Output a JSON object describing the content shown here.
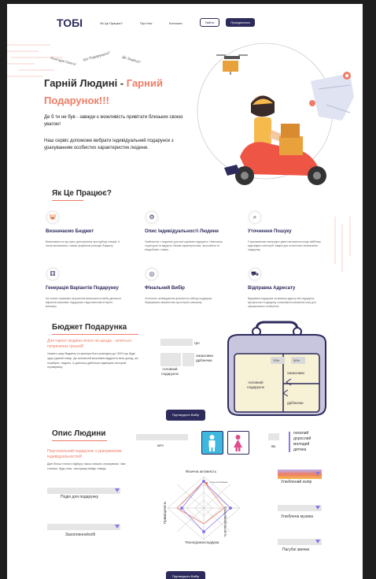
{
  "brand": {
    "logo": "ТОБІ"
  },
  "nav": {
    "items": [
      "Як Це Працює?",
      "Про Нас",
      "Контакти"
    ],
    "login": "Увійти",
    "signup": "Приєднатися"
  },
  "hero": {
    "notes": [
      "Сьогодні Свято!",
      "Що Подарувати?",
      "Де Знайти?"
    ],
    "title_plain": "Гарній Людині - ",
    "title_accent_1": "Гарний",
    "title_accent_2": "Подарунок!!!",
    "p1": "Де б ти не був - завжди є можливість привітати близьких своєю увагою!",
    "p2": "Наш сервіс допоможе вибрати індивідуальний подарунок з урахуванням особистих характеристик людини."
  },
  "how": {
    "title": "Як Це Працює?",
    "features": [
      {
        "icon": "piggy-bank-icon",
        "glyph": "🐷",
        "title": "Визначаємо Бюджет",
        "text": "Визначаємо на яку суму орієнтуватися при підбору товарів. А також визначаємо з якими форматом розподіл бюджету."
      },
      {
        "icon": "person-gear-icon",
        "glyph": "⚙",
        "title": "Опис Індивідуальності Людини",
        "text": "Знайомство з людиною для якої шукаємо подарунок. Невеличка структурна та відкрита. Вікова характеристика, захоплення та вподобання і смаки."
      },
      {
        "icon": "search-icon",
        "glyph": "⌕",
        "title": "Уточнення Пошуку",
        "text": "З врахуванням попередніх даних визначена пошук найбільш відповідних категорій товарів для остаточного визначення подарунку."
      },
      {
        "icon": "dice-icon",
        "glyph": "⚅",
        "title": "Генерація Варіантів Подарунку",
        "text": "На основі отриманих результатів визначається вибір декількох варіантів можливих подарунків з відстеженням інтернет-магазину."
      },
      {
        "icon": "target-icon",
        "glyph": "◎",
        "title": "Фінальний Вибір",
        "text": "Остаточне затвердження фінального набору подарунку. Формування замовлення під інтернет-магазину."
      },
      {
        "icon": "delivery-icon",
        "glyph": "⛟",
        "title": "Відправка Адресату",
        "text": "Відправка подарунка на вказану адресу або подарунок віртуального подарунку з можливістю вказання часу для сформованого побачення."
      }
    ]
  },
  "budget": {
    "title": "Бюджет Подарунка",
    "lead": "Для гарної людини нічого не шкода - хочеться потрачених грошей!",
    "text": "Укажіть суму бюджету та принцип його розподілу до 100% що буде одну єдиний товар. До скількісній можливих відділити весь доход, які позабули, людина. А декілька дрібничок підвищить вісторий отримувачу.",
    "grn": "грн",
    "main_gift": "головний подарунок",
    "small_gifts": "смаколики дрібнички",
    "pct_a": "70%",
    "pct_b": "30%",
    "wallet_main": "головний подарунок",
    "wallet_small": "смаколики",
    "wallet_trifles": "дрібнички",
    "confirm": "Підтвердити Вибір"
  },
  "person": {
    "title": "Опис Людини",
    "lead": "Персональний подарунок з урахуванням індивідуальностей!",
    "text": "Дані більш точного підбору також опишіть отримувача. Чим точніше, будь опис, тим краща вийде товару.",
    "name_label": "Ім'я",
    "age_label": "вік",
    "age_options": [
      "похилий",
      "дорослий",
      "молодий",
      "дитина"
    ],
    "occasion": "Подія для подарунку",
    "hobby": "Захоплення/хобі",
    "fav_color": "Улюблений колір",
    "fav_music": "Улюблена музика",
    "bad_habits": "Пагубні звички",
    "radar": {
      "top": "Фізична активність",
      "right": "Комунікабельність",
      "bottom": "Техно/домосподарка",
      "left": "Приміщеність",
      "legend": "Ходы витримані"
    },
    "confirm": "Підтвердити Вибір"
  },
  "colors": {
    "accent": "#ee7d67",
    "primary": "#2d2b5c",
    "purple": "#8a79e8",
    "male": "#3fb8e0",
    "female": "#e04a8a"
  }
}
